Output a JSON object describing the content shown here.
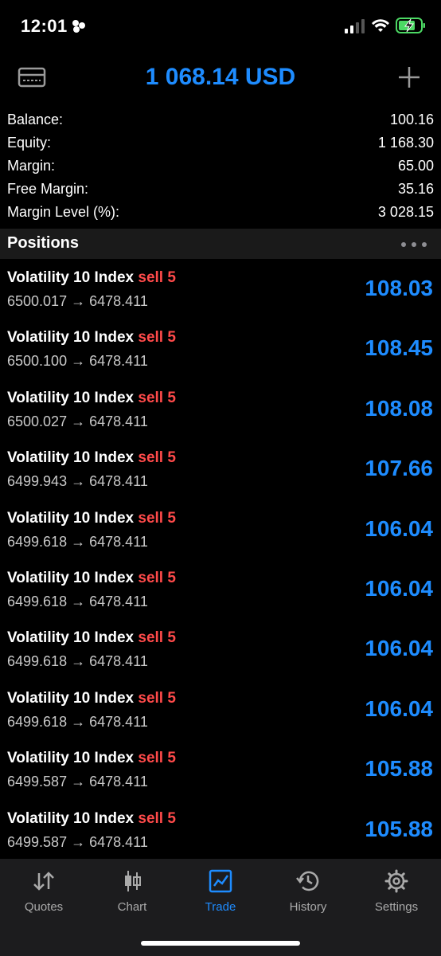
{
  "status": {
    "time": "12:01"
  },
  "header": {
    "title": "1 068.14 USD",
    "left_icon": "card-icon",
    "right_icon": "plus-icon"
  },
  "summary": [
    {
      "label": "Balance:",
      "value": "100.16"
    },
    {
      "label": "Equity:",
      "value": "1 168.30"
    },
    {
      "label": "Margin:",
      "value": "65.00"
    },
    {
      "label": "Free Margin:",
      "value": "35.16"
    },
    {
      "label": "Margin Level (%):",
      "value": "3 028.15"
    }
  ],
  "positions": {
    "title": "Positions",
    "items": [
      {
        "symbol": "Volatility 10 Index",
        "side": "sell 5",
        "open": "6500.017",
        "current": "6478.411",
        "profit": "108.03"
      },
      {
        "symbol": "Volatility 10 Index",
        "side": "sell 5",
        "open": "6500.100",
        "current": "6478.411",
        "profit": "108.45"
      },
      {
        "symbol": "Volatility 10 Index",
        "side": "sell 5",
        "open": "6500.027",
        "current": "6478.411",
        "profit": "108.08"
      },
      {
        "symbol": "Volatility 10 Index",
        "side": "sell 5",
        "open": "6499.943",
        "current": "6478.411",
        "profit": "107.66"
      },
      {
        "symbol": "Volatility 10 Index",
        "side": "sell 5",
        "open": "6499.618",
        "current": "6478.411",
        "profit": "106.04"
      },
      {
        "symbol": "Volatility 10 Index",
        "side": "sell 5",
        "open": "6499.618",
        "current": "6478.411",
        "profit": "106.04"
      },
      {
        "symbol": "Volatility 10 Index",
        "side": "sell 5",
        "open": "6499.618",
        "current": "6478.411",
        "profit": "106.04"
      },
      {
        "symbol": "Volatility 10 Index",
        "side": "sell 5",
        "open": "6499.618",
        "current": "6478.411",
        "profit": "106.04"
      },
      {
        "symbol": "Volatility 10 Index",
        "side": "sell 5",
        "open": "6499.587",
        "current": "6478.411",
        "profit": "105.88"
      },
      {
        "symbol": "Volatility 10 Index",
        "side": "sell 5",
        "open": "6499.587",
        "current": "6478.411",
        "profit": "105.88"
      }
    ]
  },
  "tabs": [
    {
      "label": "Quotes",
      "icon": "quotes-arrows-icon"
    },
    {
      "label": "Chart",
      "icon": "candlestick-icon"
    },
    {
      "label": "Trade",
      "icon": "trade-chart-icon",
      "active": true
    },
    {
      "label": "History",
      "icon": "history-icon"
    },
    {
      "label": "Settings",
      "icon": "gear-icon"
    }
  ],
  "colors": {
    "accent": "#1e8cff",
    "sell": "#ff4a4a",
    "background": "#000000",
    "tabbar": "#1c1c1e"
  }
}
